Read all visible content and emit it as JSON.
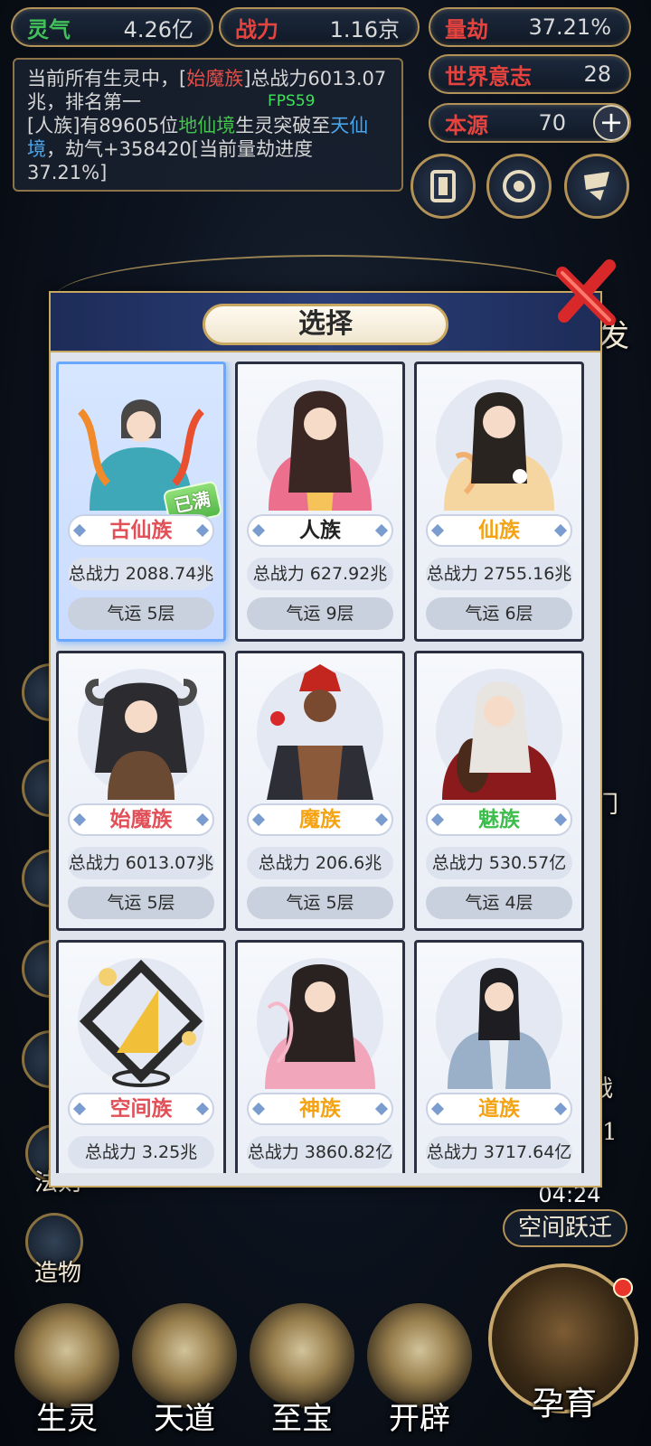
{
  "stats": {
    "lingqi": {
      "label": "灵气",
      "value": "4.26亿"
    },
    "zhanli": {
      "label": "战力",
      "value": "1.16京"
    },
    "liangjie": {
      "label": "量劫",
      "value": "37.21%"
    },
    "shijie": {
      "label": "世界意志",
      "value": "28"
    },
    "benyuan": {
      "label": "本源",
      "value": "70"
    }
  },
  "log": {
    "line1_a": "当前所有生灵中，[",
    "line1_race": "始魔族",
    "line1_b": "]总战力6013.07兆，排名第一",
    "line2_a": "[人族]有89605位",
    "line2_realm": "地仙境",
    "line2_b": "生灵突破至",
    "line2_target": "天仙境",
    "line2_c": "，劫气+358420[当前量劫进度37.21%]"
  },
  "fps": "FPS59",
  "side_labels": {
    "fa": "法则",
    "zao": "造物",
    "fa_short": "发",
    "men": "门",
    "zhan": "战",
    "num": "1"
  },
  "timer": "04:24",
  "jump_label": "空间跃迁",
  "nav": [
    "生灵",
    "天道",
    "至宝",
    "开辟"
  ],
  "main_nav": "孕育",
  "modal": {
    "title": "选择",
    "full_badge": "已满",
    "cards": [
      {
        "name": "古仙族",
        "power": "总战力 2088.74兆",
        "luck": "气运 5层",
        "color": "#e14f57"
      },
      {
        "name": "人族",
        "power": "总战力 627.92兆",
        "luck": "气运 9层",
        "color": "#222222"
      },
      {
        "name": "仙族",
        "power": "总战力 2755.16兆",
        "luck": "气运 6层",
        "color": "#f5a312"
      },
      {
        "name": "始魔族",
        "power": "总战力 6013.07兆",
        "luck": "气运 5层",
        "color": "#e14f57"
      },
      {
        "name": "魔族",
        "power": "总战力 206.6兆",
        "luck": "气运 5层",
        "color": "#f5a312"
      },
      {
        "name": "魅族",
        "power": "总战力 530.57亿",
        "luck": "气运 4层",
        "color": "#3cbd4c"
      },
      {
        "name": "空间族",
        "power": "总战力 3.25兆",
        "luck": "",
        "color": "#e14f57"
      },
      {
        "name": "神族",
        "power": "总战力 3860.82亿",
        "luck": "",
        "color": "#f5a312"
      },
      {
        "name": "道族",
        "power": "总战力 3717.64亿",
        "luck": "",
        "color": "#f5a312"
      }
    ]
  }
}
